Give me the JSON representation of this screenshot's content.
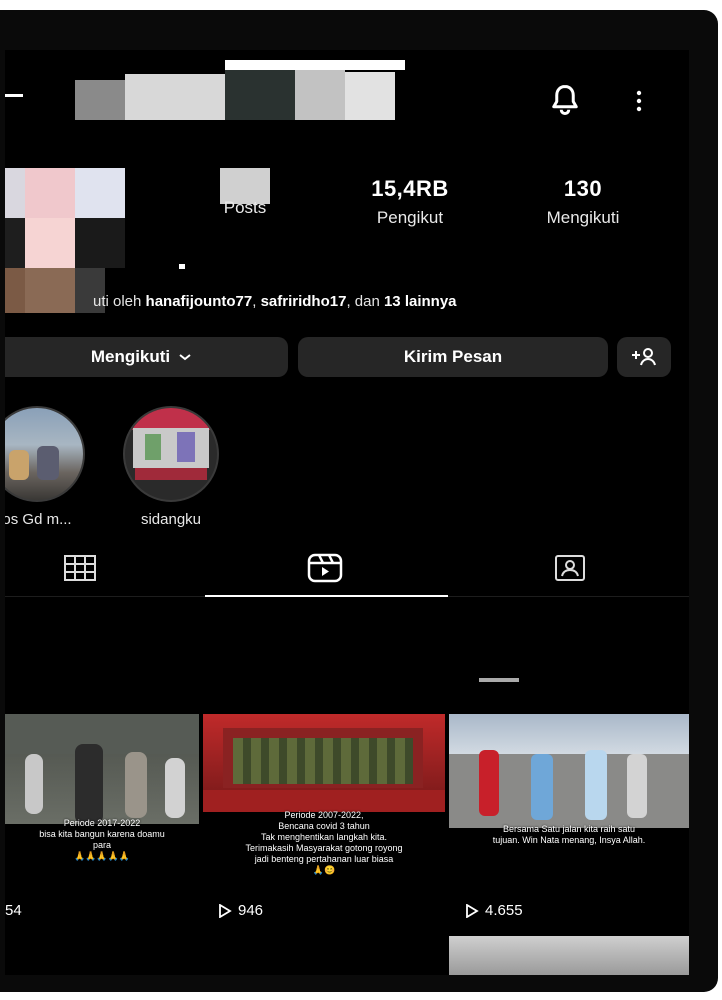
{
  "stats": [
    {
      "value": "",
      "label": "Posts"
    },
    {
      "value": "15,4RB",
      "label": "Pengikut"
    },
    {
      "value": "130",
      "label": "Mengikuti"
    }
  ],
  "followed_by": {
    "prefix": "uti oleh ",
    "user1": "hanafijounto77",
    "sep": ", ",
    "user2": "safriridho17",
    "mid": ", dan ",
    "others": "13 lainnya"
  },
  "buttons": {
    "following_label": "Mengikuti",
    "message_label": "Kirim Pesan"
  },
  "highlights": [
    {
      "label": "os Gd m..."
    },
    {
      "label": "sidangku"
    }
  ],
  "tabs": [
    {
      "icon": "grid-icon"
    },
    {
      "icon": "reels-icon"
    },
    {
      "icon": "tagged-icon"
    }
  ],
  "reels": [
    {
      "caption": "Periode 2017-2022\nbisa kita bangun karena doamu\npara\n🙏🙏🙏🙏🙏",
      "views": "54"
    },
    {
      "caption": "Periode 2007-2022,\nBencana covid 3 tahun\nTak menghentikan langkah kita.\nTerimakasih Masyarakat gotong royong\njadi benteng pertahanan luar biasa\n🙏😊",
      "views": "946"
    },
    {
      "caption": "Bersama Satu jalan kita raih satu\ntujuan. Win Nata menang, Insya Allah.",
      "views": "4.655"
    }
  ],
  "colors": {
    "background": "#000000",
    "button": "#262626"
  }
}
